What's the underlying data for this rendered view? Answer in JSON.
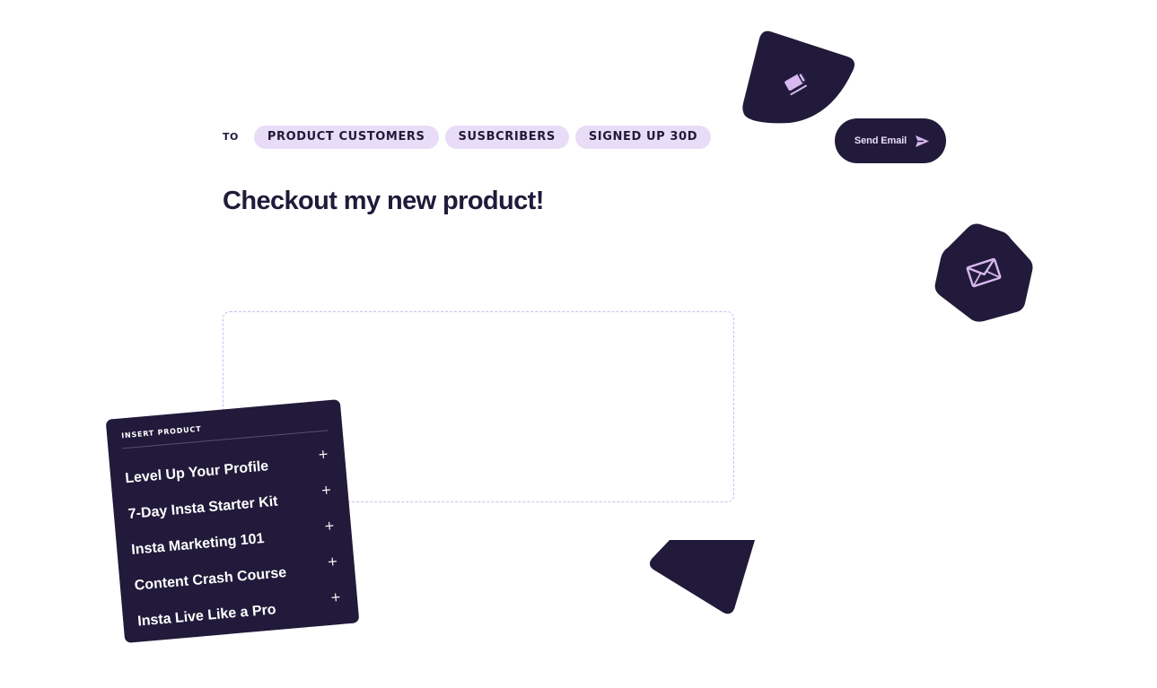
{
  "colors": {
    "ink": "#211a3a",
    "chip_bg": "#e9dcf7",
    "accent": "#d7b8f0",
    "dash": "#c7c0f0",
    "background": "#ffffff"
  },
  "recipients": {
    "to_label": "TO",
    "chips": [
      "PRODUCT CUSTOMERS",
      "SUSBCRIBERS",
      "SIGNED UP 30D"
    ]
  },
  "email": {
    "subject": "Checkout my new product!"
  },
  "actions": {
    "send_label": "Send Email",
    "send_icon": "send-icon",
    "edit_icon": "edit-icon",
    "mail_icon": "mail-icon"
  },
  "insert_product": {
    "title": "INSERT PRODUCT",
    "add_symbol": "+",
    "items": [
      "Level Up Your Profile",
      "7-Day Insta Starter Kit",
      "Insta Marketing 101",
      "Content Crash Course",
      "Insta Live Like a Pro"
    ]
  }
}
